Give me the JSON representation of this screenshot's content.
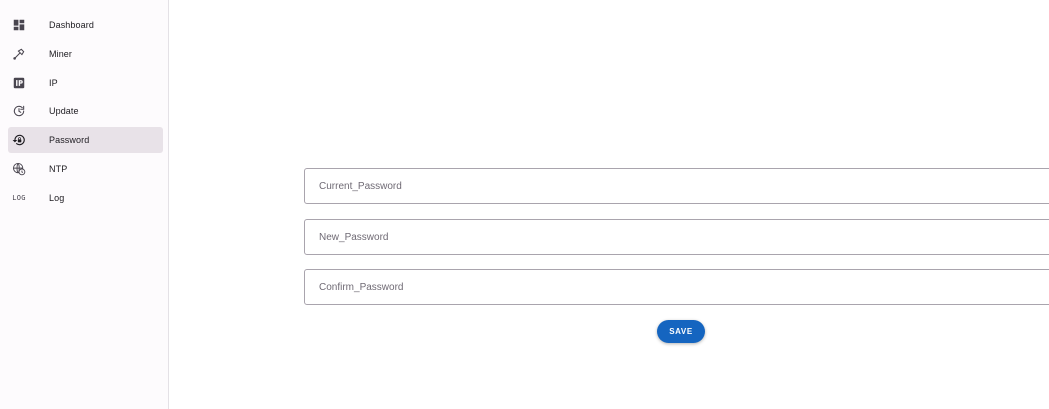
{
  "sidebar": {
    "items": [
      {
        "label": "Dashboard",
        "icon": "dashboard-icon",
        "active": false
      },
      {
        "label": "Miner",
        "icon": "pickaxe-icon",
        "active": false
      },
      {
        "label": "IP",
        "icon": "ip-icon",
        "active": false
      },
      {
        "label": "Update",
        "icon": "update-icon",
        "active": false
      },
      {
        "label": "Password",
        "icon": "lock-reset-icon",
        "active": true
      },
      {
        "label": "NTP",
        "icon": "globe-clock-icon",
        "active": false
      },
      {
        "label": "Log",
        "icon": "log-icon",
        "icon_text": "LOG",
        "active": false
      }
    ]
  },
  "form": {
    "current_password": {
      "placeholder": "Current_Password",
      "value": ""
    },
    "new_password": {
      "placeholder": "New_Password",
      "value": ""
    },
    "confirm_password": {
      "placeholder": "Confirm_Password",
      "value": ""
    },
    "save_label": "SAVE"
  },
  "colors": {
    "accent": "#1565c0",
    "active_nav_bg": "#e8e2e8",
    "sidebar_bg": "#fdfbfd"
  }
}
